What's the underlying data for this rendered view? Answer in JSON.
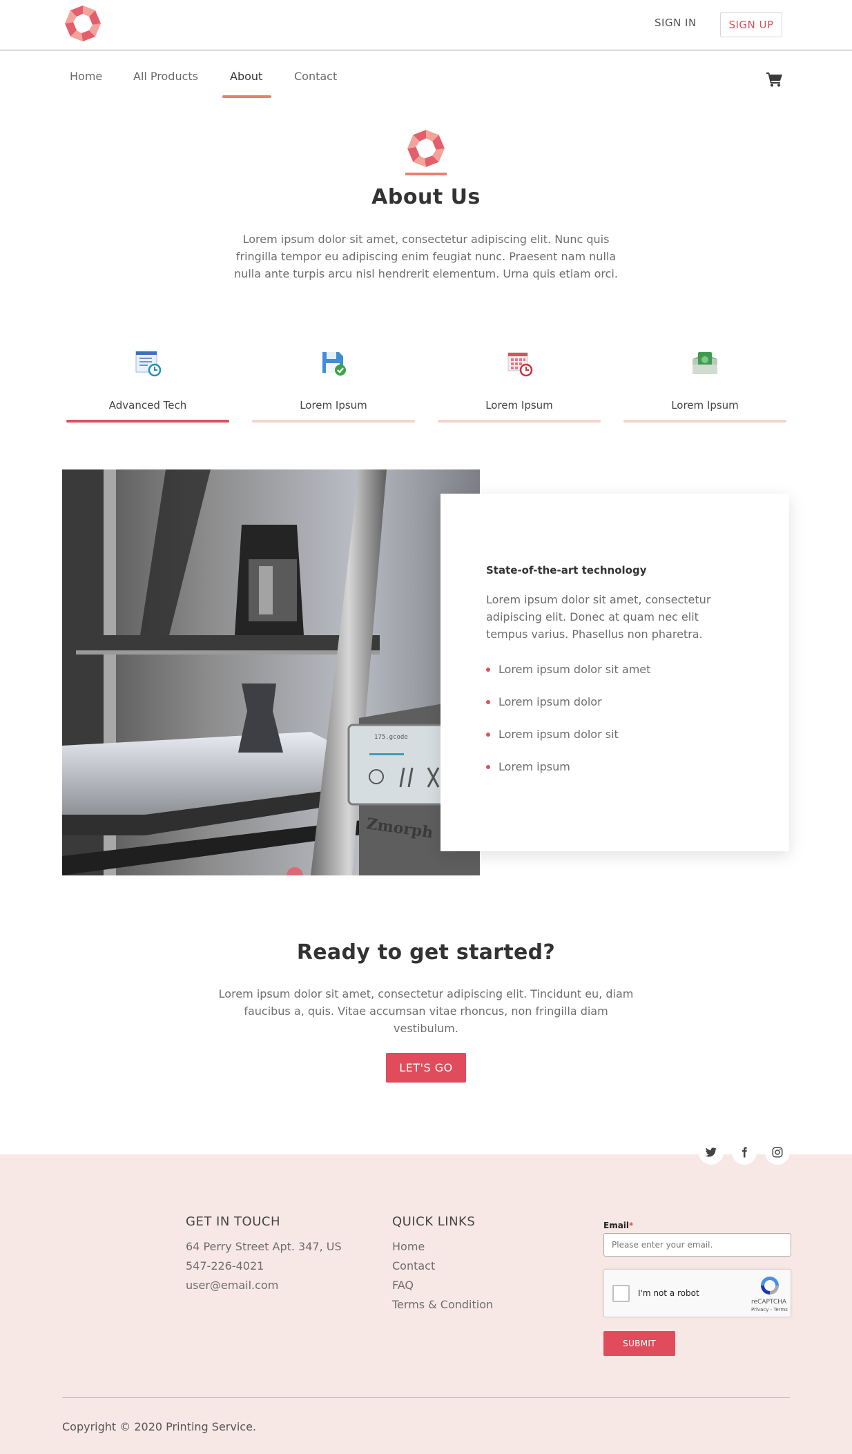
{
  "header": {
    "sign_in": "SIGN IN",
    "sign_up": "SIGN UP"
  },
  "nav": {
    "items": [
      {
        "label": "Home"
      },
      {
        "label": "All Products"
      },
      {
        "label": "About"
      },
      {
        "label": "Contact"
      }
    ],
    "active": "About"
  },
  "about": {
    "title": "About Us",
    "text": "Lorem ipsum dolor sit amet, consectetur adipiscing elit. Nunc quis fringilla tempor eu adipiscing enim feugiat nunc. Praesent nam nulla nulla ante turpis arcu nisl hendrerit elementum. Urna quis etiam orci."
  },
  "features": [
    {
      "label": "Advanced Tech",
      "icon": "document-clock-icon",
      "active": true
    },
    {
      "label": "Lorem Ipsum",
      "icon": "save-check-icon",
      "active": false
    },
    {
      "label": "Lorem Ipsum",
      "icon": "calendar-clock-icon",
      "active": false
    },
    {
      "label": "Lorem Ipsum",
      "icon": "money-icon",
      "active": false
    }
  ],
  "tech": {
    "title": "State-of-the-art technology",
    "text": "Lorem ipsum dolor sit amet, consectetur adipiscing elit. Donec at quam nec elit tempus varius. Phasellus non pharetra.",
    "list": [
      "Lorem ipsum dolor sit amet",
      "Lorem ipsum dolor",
      "Lorem ipsum dolor sit",
      "Lorem ipsum"
    ],
    "photo_screen_text": "175.gcode",
    "photo_brand": "Zmorph"
  },
  "cta": {
    "title": "Ready to get started?",
    "text": "Lorem ipsum dolor sit amet, consectetur adipiscing elit. Tincidunt eu, diam faucibus a, quis. Vitae accumsan vitae rhoncus, non fringilla diam vestibulum.",
    "button": "LET'S GO"
  },
  "footer": {
    "get_in_touch": {
      "title": "GET IN TOUCH",
      "address": "64 Perry Street Apt. 347, US",
      "phone": "547-226-4021",
      "email": "user@email.com"
    },
    "quick_links": {
      "title": "QUICK LINKS",
      "links": [
        "Home",
        "Contact",
        "FAQ",
        "Terms & Condition"
      ]
    },
    "form": {
      "email_label": "Email",
      "required_mark": "*",
      "email_placeholder": "Please enter your email.",
      "captcha_text": "I'm not a robot",
      "captcha_brand": "reCAPTCHA",
      "captcha_terms": "Privacy - Terms",
      "submit": "SUBMIT"
    },
    "copyright": "Copyright © 2020 Printing Service.",
    "social": [
      "twitter-icon",
      "facebook-icon",
      "instagram-icon"
    ]
  },
  "colors": {
    "accent": "#e04c5c",
    "accent_light": "#f5d3cf",
    "nav_underline": "#e8806f",
    "footer_bg": "#f8e8e5"
  }
}
